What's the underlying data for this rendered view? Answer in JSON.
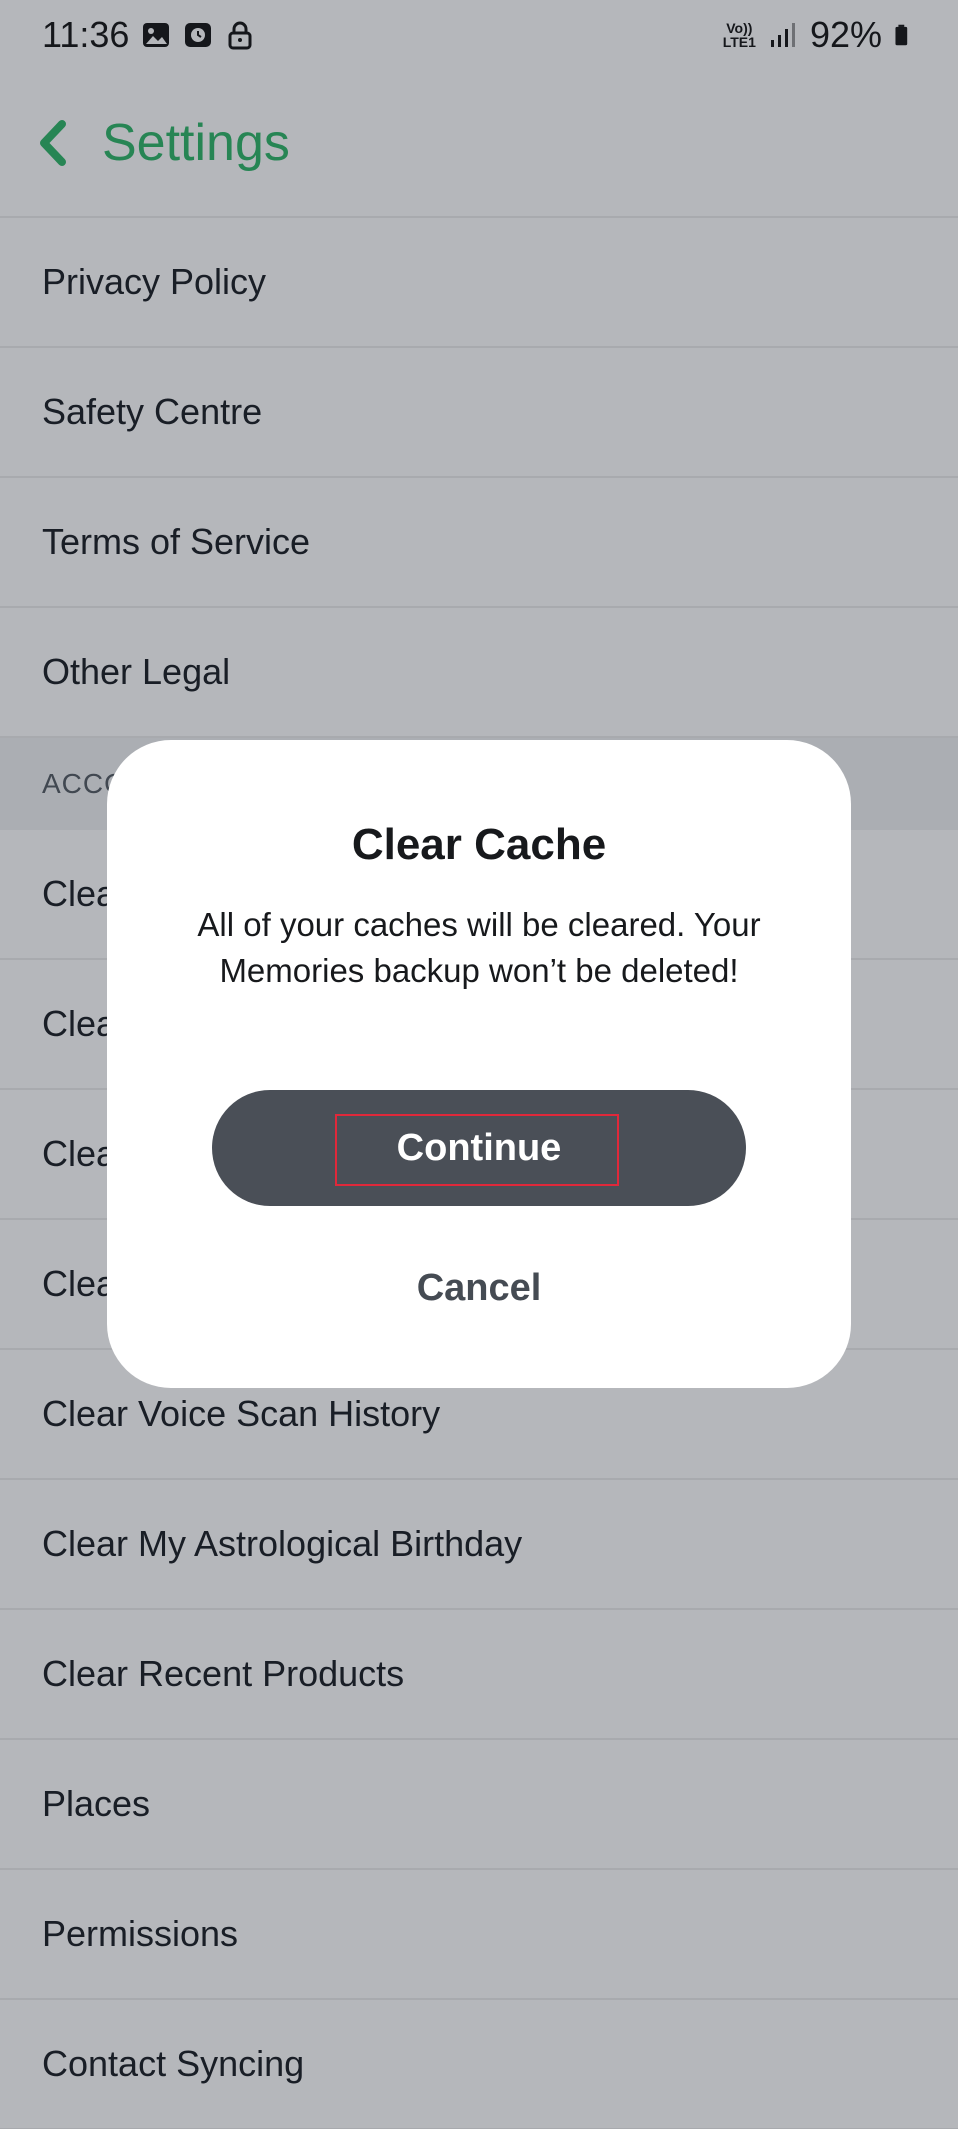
{
  "status_bar": {
    "time": "11:36",
    "battery": "92%",
    "network_top": "Vo))",
    "network_bottom": "LTE1",
    "icons": [
      "image-icon",
      "clock-icon",
      "lock-icon",
      "signal-icon",
      "battery-icon"
    ]
  },
  "header": {
    "title": "Settings",
    "accent_color": "#34b86c"
  },
  "list": {
    "items_top": [
      "Privacy Policy",
      "Safety Centre",
      "Terms of Service",
      "Other Legal"
    ],
    "section_label": "ACCO",
    "items_hidden_partial": [
      "Clea",
      "Clea",
      "Clea",
      "Clea"
    ],
    "items_bottom": [
      "Clear Voice Scan History",
      "Clear My Astrological Birthday",
      "Clear Recent Products",
      "Places",
      "Permissions",
      "Contact Syncing"
    ]
  },
  "dialog": {
    "title": "Clear Cache",
    "body": "All of your caches will be cleared. Your Memories backup won’t be deleted!",
    "continue_label": "Continue",
    "cancel_label": "Cancel"
  }
}
